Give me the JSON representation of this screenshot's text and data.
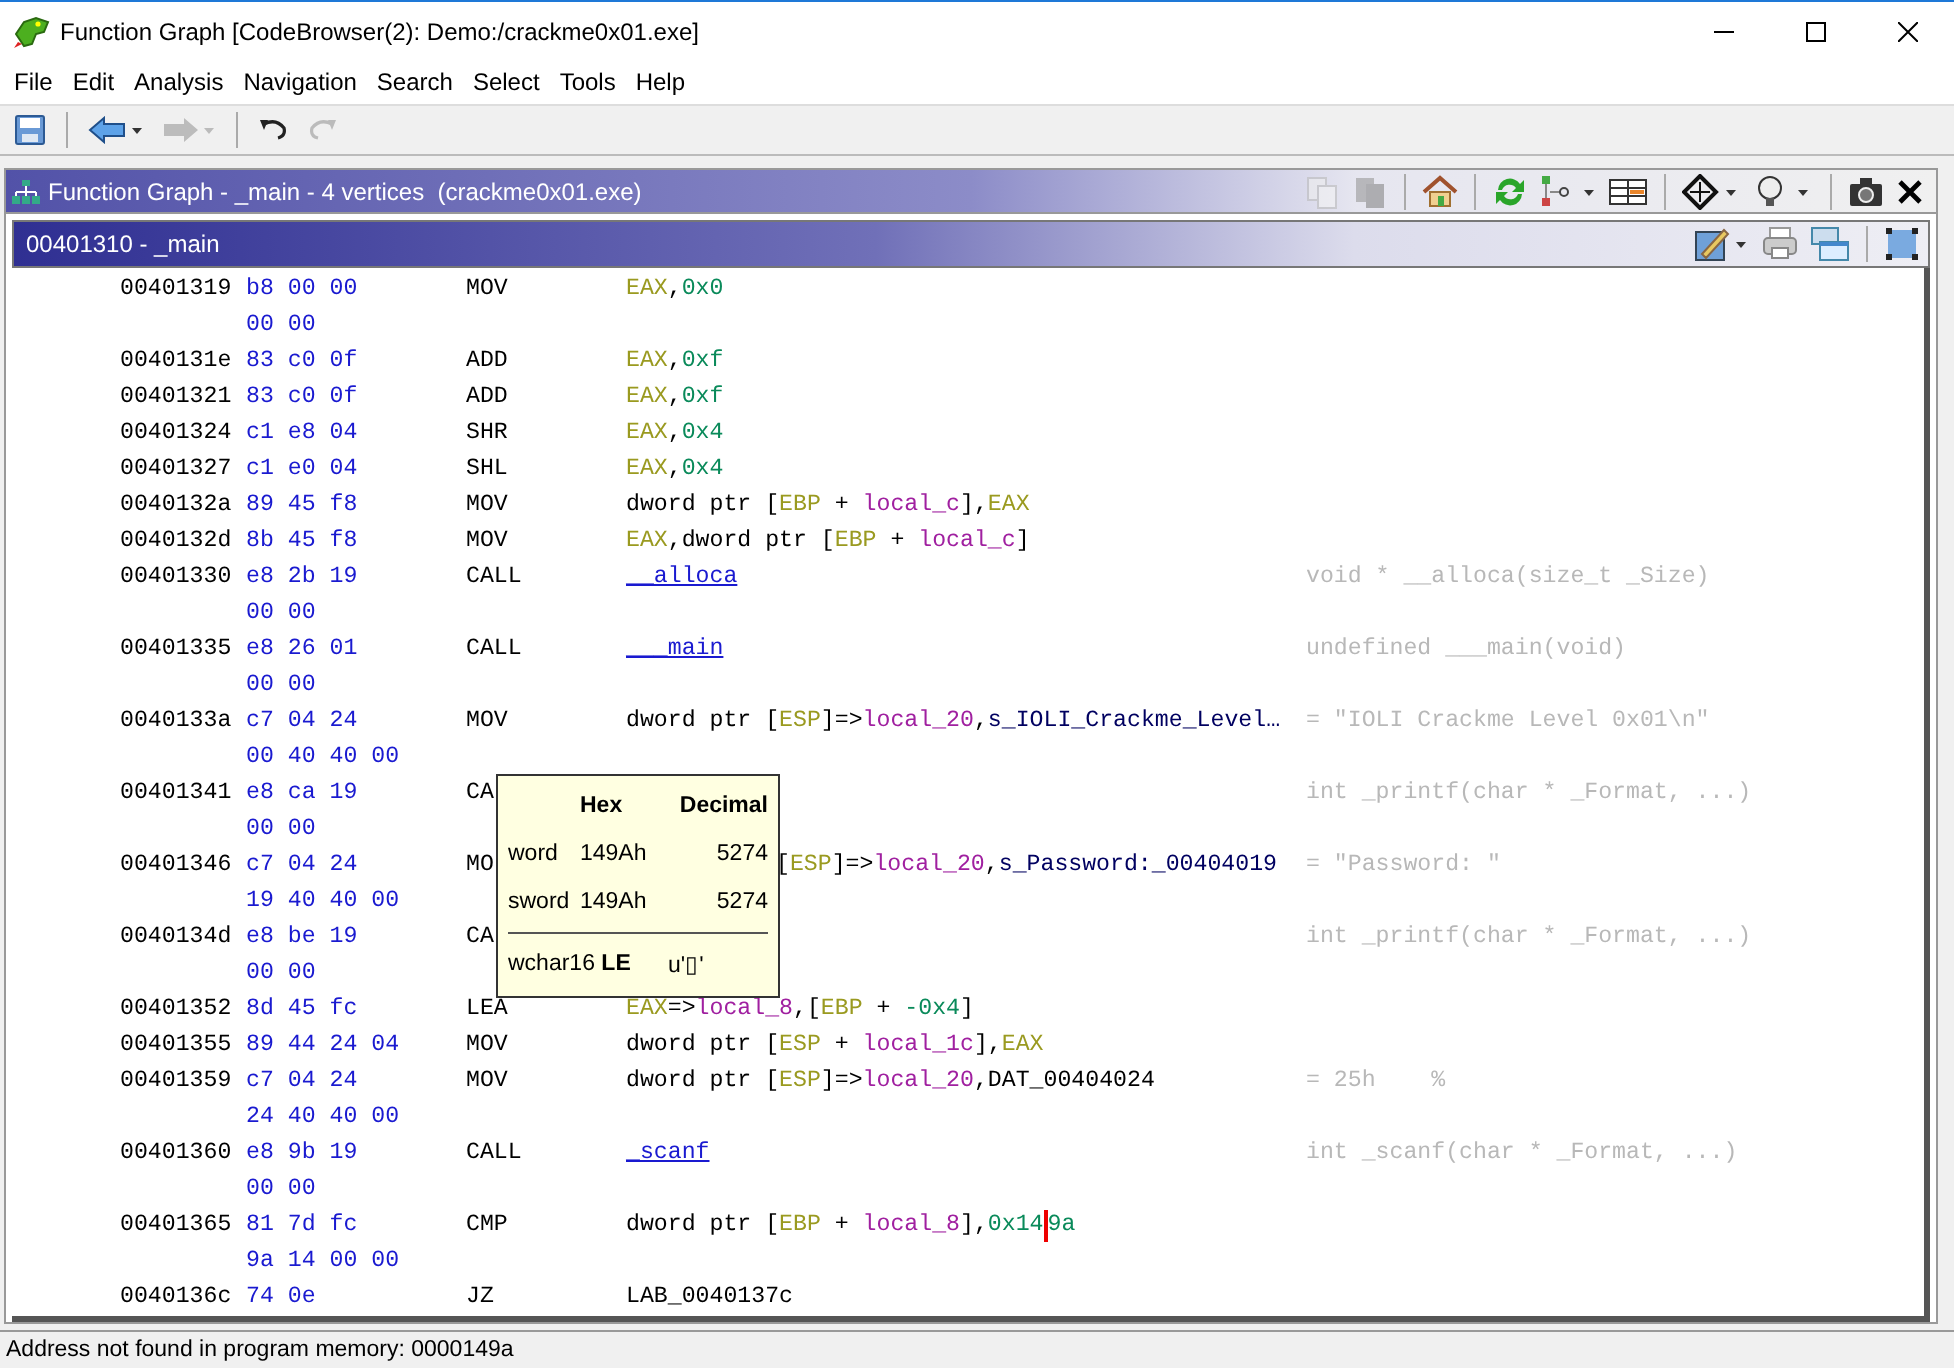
{
  "window": {
    "title": "Function Graph [CodeBrowser(2): Demo:/crackme0x01.exe]"
  },
  "menu": [
    "File",
    "Edit",
    "Analysis",
    "Navigation",
    "Search",
    "Select",
    "Tools",
    "Help"
  ],
  "toolbar": [
    {
      "kind": "save",
      "disabled": false
    },
    {
      "kind": "back",
      "disabled": false
    },
    {
      "kind": "forward",
      "disabled": true
    },
    {
      "kind": "undo",
      "disabled": false
    },
    {
      "kind": "redo",
      "disabled": true
    }
  ],
  "panel": {
    "title": "Function Graph - _main - 4 vertices  (crackme0x01.exe)"
  },
  "panel_tools": [
    {
      "kind": "copy",
      "disabled": true
    },
    {
      "kind": "paste",
      "disabled": true
    },
    {
      "kind": "home",
      "disabled": false
    },
    {
      "kind": "refresh",
      "disabled": false
    },
    {
      "kind": "layout",
      "disabled": false
    },
    {
      "kind": "table",
      "disabled": false
    },
    {
      "kind": "navigate",
      "disabled": false
    },
    {
      "kind": "bulb",
      "disabled": false
    },
    {
      "kind": "camera",
      "disabled": false
    },
    {
      "kind": "close",
      "disabled": false
    }
  ],
  "node": {
    "title": "00401310 - _main"
  },
  "listing": [
    {
      "kind": "full",
      "address": "00401319",
      "bytes": "b8 00 00",
      "mnemonic": "MOV",
      "operands": [
        {
          "kind": "reg",
          "text": "EAX"
        },
        {
          "kind": "plain",
          "text": ","
        },
        {
          "kind": "num",
          "text": "0x0"
        }
      ],
      "more_bytes": "00 00"
    },
    {
      "kind": "full",
      "address": "0040131e",
      "bytes": "83 c0 0f",
      "mnemonic": "ADD",
      "operands": [
        {
          "kind": "reg",
          "text": "EAX"
        },
        {
          "kind": "plain",
          "text": ","
        },
        {
          "kind": "num",
          "text": "0xf"
        }
      ]
    },
    {
      "kind": "full",
      "address": "00401321",
      "bytes": "83 c0 0f",
      "mnemonic": "ADD",
      "operands": [
        {
          "kind": "reg",
          "text": "EAX"
        },
        {
          "kind": "plain",
          "text": ","
        },
        {
          "kind": "num",
          "text": "0xf"
        }
      ]
    },
    {
      "kind": "full",
      "address": "00401324",
      "bytes": "c1 e8 04",
      "mnemonic": "SHR",
      "operands": [
        {
          "kind": "reg",
          "text": "EAX"
        },
        {
          "kind": "plain",
          "text": ","
        },
        {
          "kind": "num",
          "text": "0x4"
        }
      ]
    },
    {
      "kind": "full",
      "address": "00401327",
      "bytes": "c1 e0 04",
      "mnemonic": "SHL",
      "operands": [
        {
          "kind": "reg",
          "text": "EAX"
        },
        {
          "kind": "plain",
          "text": ","
        },
        {
          "kind": "num",
          "text": "0x4"
        }
      ]
    },
    {
      "kind": "full",
      "address": "0040132a",
      "bytes": "89 45 f8",
      "mnemonic": "MOV",
      "operands": [
        {
          "kind": "plain",
          "text": "dword ptr ["
        },
        {
          "kind": "reg",
          "text": "EBP"
        },
        {
          "kind": "plain",
          "text": " + "
        },
        {
          "kind": "local",
          "text": "local_c"
        },
        {
          "kind": "plain",
          "text": "],"
        },
        {
          "kind": "reg",
          "text": "EAX"
        }
      ]
    },
    {
      "kind": "full",
      "address": "0040132d",
      "bytes": "8b 45 f8",
      "mnemonic": "MOV",
      "operands": [
        {
          "kind": "reg",
          "text": "EAX"
        },
        {
          "kind": "plain",
          "text": ",dword ptr ["
        },
        {
          "kind": "reg",
          "text": "EBP"
        },
        {
          "kind": "plain",
          "text": " + "
        },
        {
          "kind": "local",
          "text": "local_c"
        },
        {
          "kind": "plain",
          "text": "]"
        }
      ]
    },
    {
      "kind": "full",
      "address": "00401330",
      "bytes": "e8 2b 19",
      "mnemonic": "CALL",
      "operands": [
        {
          "kind": "fn",
          "text": "__alloca"
        }
      ],
      "comment": "void * __alloca(size_t _Size)",
      "more_bytes": "00 00"
    },
    {
      "kind": "full",
      "address": "00401335",
      "bytes": "e8 26 01",
      "mnemonic": "CALL",
      "operands": [
        {
          "kind": "fn",
          "text": "___main"
        }
      ],
      "comment": "undefined ___main(void)",
      "more_bytes": "00 00"
    },
    {
      "kind": "full",
      "address": "0040133a",
      "bytes": "c7 04 24",
      "mnemonic": "MOV",
      "operands": [
        {
          "kind": "plain",
          "text": "dword ptr ["
        },
        {
          "kind": "reg",
          "text": "ESP"
        },
        {
          "kind": "plain",
          "text": "]=>"
        },
        {
          "kind": "local",
          "text": "local_20"
        },
        {
          "kind": "plain",
          "text": ","
        },
        {
          "kind": "sym",
          "text": "s_IOLI_Crackme_Level…"
        }
      ],
      "comment": "= \"IOLI Crackme Level 0x01\\n\"",
      "more_bytes": "00 40 40 00"
    },
    {
      "kind": "covered",
      "address": "00401341",
      "bytes": "e8 ca 19",
      "mnemonic": "CA",
      "comment": "int _printf(char * _Format, ...)",
      "more_bytes": "00 00"
    },
    {
      "kind": "covered",
      "address": "00401346",
      "bytes": "c7 04 24",
      "mnemonic": "MO",
      "operands": [
        {
          "kind": "plain",
          "text": "["
        },
        {
          "kind": "reg",
          "text": "ESP"
        },
        {
          "kind": "plain",
          "text": "]=>"
        },
        {
          "kind": "local",
          "text": "local_20"
        },
        {
          "kind": "plain",
          "text": ","
        },
        {
          "kind": "sym",
          "text": "s_Password:_00404019"
        }
      ],
      "comment": "= \"Password: \"",
      "more_bytes": "19 40 40 00"
    },
    {
      "kind": "covered",
      "address": "0040134d",
      "bytes": "e8 be 19",
      "mnemonic": "CA",
      "comment": "int _printf(char * _Format, ...)",
      "more_bytes": "00 00"
    },
    {
      "kind": "full",
      "address": "00401352",
      "bytes": "8d 45 fc",
      "mnemonic": "LEA",
      "operands": [
        {
          "kind": "reg",
          "text": "EAX"
        },
        {
          "kind": "plain",
          "text": "=>"
        },
        {
          "kind": "local",
          "text": "local_8"
        },
        {
          "kind": "plain",
          "text": ",["
        },
        {
          "kind": "reg",
          "text": "EBP"
        },
        {
          "kind": "plain",
          "text": " + "
        },
        {
          "kind": "num",
          "text": "-0x4"
        },
        {
          "kind": "plain",
          "text": "]"
        }
      ]
    },
    {
      "kind": "full",
      "address": "00401355",
      "bytes": "89 44 24 04",
      "mnemonic": "MOV",
      "operands": [
        {
          "kind": "plain",
          "text": "dword ptr ["
        },
        {
          "kind": "reg",
          "text": "ESP"
        },
        {
          "kind": "plain",
          "text": " + "
        },
        {
          "kind": "local",
          "text": "local_1c"
        },
        {
          "kind": "plain",
          "text": "],"
        },
        {
          "kind": "reg",
          "text": "EAX"
        }
      ]
    },
    {
      "kind": "full",
      "address": "00401359",
      "bytes": "c7 04 24",
      "mnemonic": "MOV",
      "operands": [
        {
          "kind": "plain",
          "text": "dword ptr ["
        },
        {
          "kind": "reg",
          "text": "ESP"
        },
        {
          "kind": "plain",
          "text": "]=>"
        },
        {
          "kind": "local",
          "text": "local_20"
        },
        {
          "kind": "plain",
          "text": ",DAT_00404024"
        }
      ],
      "comment": "= 25h    %",
      "more_bytes": "24 40 40 00"
    },
    {
      "kind": "full",
      "address": "00401360",
      "bytes": "e8 9b 19",
      "mnemonic": "CALL",
      "operands": [
        {
          "kind": "fn",
          "text": "_scanf"
        }
      ],
      "comment": "int _scanf(char * _Format, ...)",
      "more_bytes": "00 00"
    },
    {
      "kind": "full",
      "address": "00401365",
      "bytes": "81 7d fc",
      "mnemonic": "CMP",
      "operands": [
        {
          "kind": "plain",
          "text": "dword ptr ["
        },
        {
          "kind": "reg",
          "text": "EBP"
        },
        {
          "kind": "plain",
          "text": " + "
        },
        {
          "kind": "local",
          "text": "local_8"
        },
        {
          "kind": "plain",
          "text": "],"
        },
        {
          "kind": "num",
          "text": "0x14"
        },
        {
          "kind": "cursor"
        },
        {
          "kind": "num",
          "text": "9a"
        }
      ],
      "more_bytes": "9a 14 00 00"
    },
    {
      "kind": "full",
      "address": "0040136c",
      "bytes": "74 0e",
      "mnemonic": "JZ",
      "operands": [
        {
          "kind": "plain",
          "text": "LAB_0040137c"
        }
      ]
    }
  ],
  "tooltip": {
    "columns": [
      "Hex",
      "Decimal"
    ],
    "rows": [
      {
        "name": "word",
        "hex": "149Ah",
        "decimal": "5274"
      },
      {
        "name": "sword",
        "hex": "149Ah",
        "decimal": "5274"
      }
    ],
    "char_row": {
      "name": "wchar16 **LE**",
      "value": "u'▯'"
    }
  },
  "status_bar": "Address not found in program memory: 0000149a"
}
